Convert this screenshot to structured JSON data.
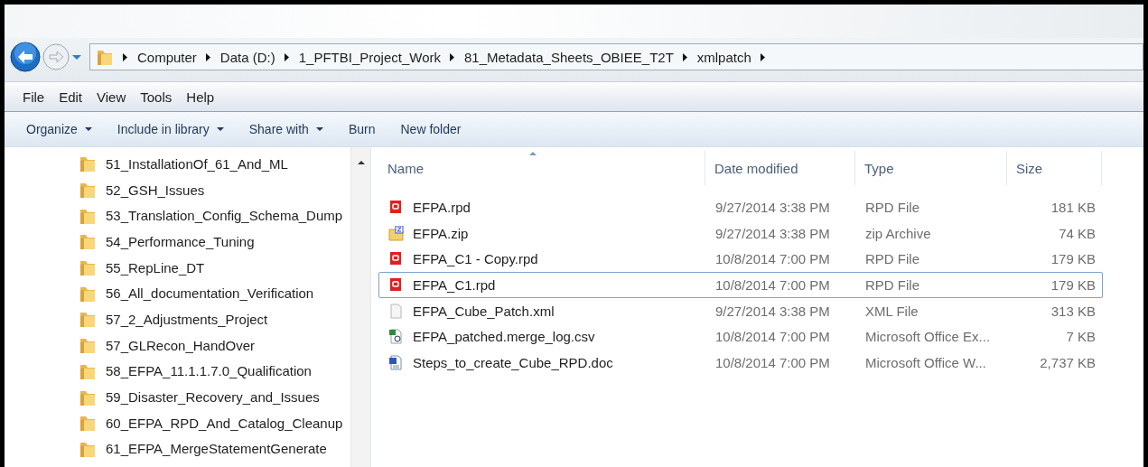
{
  "address_bar": {
    "crumbs": [
      "Computer",
      "Data (D:)",
      "1_PFTBI_Project_Work",
      "81_Metadata_Sheets_OBIEE_T2T",
      "xmlpatch"
    ]
  },
  "menu_bar": [
    "File",
    "Edit",
    "View",
    "Tools",
    "Help"
  ],
  "toolbar": [
    {
      "label": "Organize",
      "dropdown": true
    },
    {
      "label": "Include in library",
      "dropdown": true
    },
    {
      "label": "Share with",
      "dropdown": true
    },
    {
      "label": "Burn",
      "dropdown": false
    },
    {
      "label": "New folder",
      "dropdown": false
    }
  ],
  "folder_tree": [
    {
      "label": "51_InstallationOf_61_And_ML"
    },
    {
      "label": "52_GSH_Issues"
    },
    {
      "label": "53_Translation_Config_Schema_Dump"
    },
    {
      "label": "54_Performance_Tuning"
    },
    {
      "label": "55_RepLine_DT"
    },
    {
      "label": "56_All_documentation_Verification"
    },
    {
      "label": "57_2_Adjustments_Project"
    },
    {
      "label": "57_GLRecon_HandOver"
    },
    {
      "label": "58_EFPA_11.1.1.7.0_Qualification"
    },
    {
      "label": "59_Disaster_Recovery_and_Issues"
    },
    {
      "label": "60_EFPA_RPD_And_Catalog_Cleanup"
    },
    {
      "label": "61_EFPA_MergeStatementGenerate"
    }
  ],
  "file_list": {
    "columns": [
      "Name",
      "Date modified",
      "Type",
      "Size"
    ],
    "rows": [
      {
        "kind": "rpd",
        "name": "EFPA.rpd",
        "date": "9/27/2014 3:38 PM",
        "type": "RPD File",
        "size": "181 KB",
        "selected": false
      },
      {
        "kind": "zip",
        "name": "EFPA.zip",
        "date": "9/27/2014 3:38 PM",
        "type": "zip Archive",
        "size": "74 KB",
        "selected": false
      },
      {
        "kind": "rpd",
        "name": "EFPA_C1 - Copy.rpd",
        "date": "10/8/2014 7:00 PM",
        "type": "RPD File",
        "size": "179 KB",
        "selected": false
      },
      {
        "kind": "rpd",
        "name": "EFPA_C1.rpd",
        "date": "10/8/2014 7:00 PM",
        "type": "RPD File",
        "size": "179 KB",
        "selected": true
      },
      {
        "kind": "xml",
        "name": "EFPA_Cube_Patch.xml",
        "date": "9/27/2014 3:38 PM",
        "type": "XML File",
        "size": "313 KB",
        "selected": false
      },
      {
        "kind": "csv",
        "name": "EFPA_patched.merge_log.csv",
        "date": "10/8/2014 7:00 PM",
        "type": "Microsoft Office Ex...",
        "size": "7 KB",
        "selected": false
      },
      {
        "kind": "doc",
        "name": "Steps_to_create_Cube_RPD.doc",
        "date": "10/8/2014 7:00 PM",
        "type": "Microsoft Office W...",
        "size": "2,737 KB",
        "selected": false
      }
    ]
  }
}
